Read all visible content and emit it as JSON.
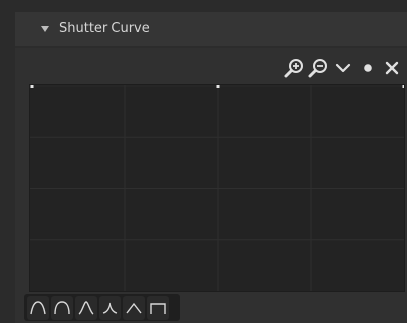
{
  "panel": {
    "title": "Shutter Curve",
    "collapsed": false
  },
  "toolbar": {
    "icons": [
      "zoom-in-icon",
      "zoom-out-icon",
      "chevron-down-icon",
      "dot-icon",
      "close-icon"
    ]
  },
  "curve": {
    "control_points": [
      [
        0,
        1
      ],
      [
        0.5,
        1
      ],
      [
        1,
        1
      ]
    ]
  },
  "presets": {
    "icons": [
      "smooth-preset-icon",
      "sphere-preset-icon",
      "root-preset-icon",
      "sharp-preset-icon",
      "linear-preset-icon",
      "max-preset-icon"
    ]
  },
  "colors": {
    "panel_bg": "#303030",
    "header_bg": "#353535",
    "curve_bg": "#232323",
    "grid": "#2f2f2f",
    "point": "#e6e6e6",
    "icon": "#e0e0e0"
  }
}
